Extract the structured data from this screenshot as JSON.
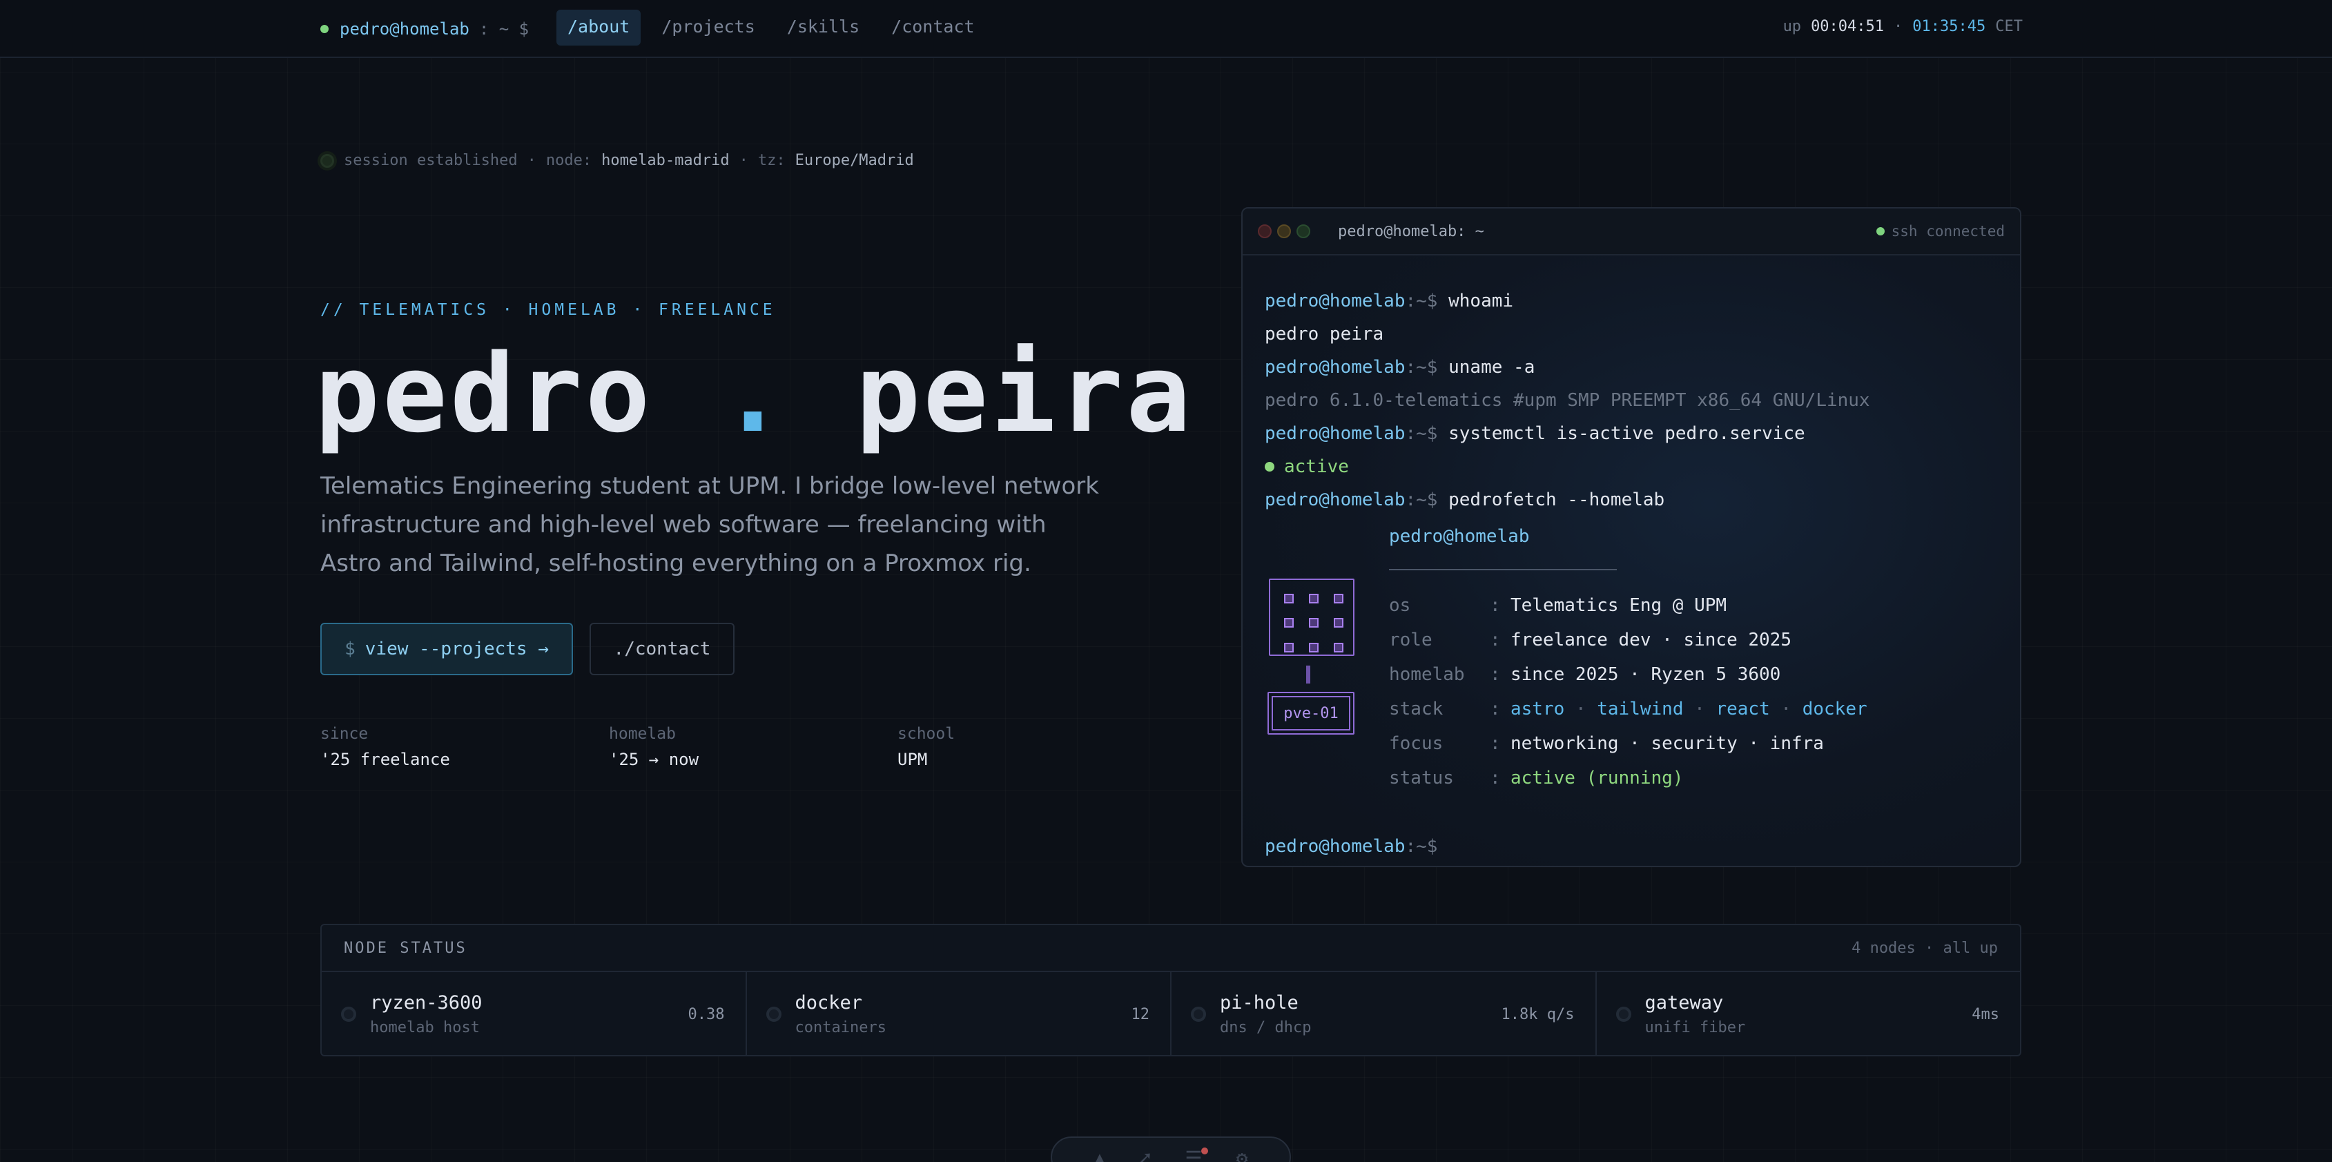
{
  "topbar": {
    "prompt_user": "pedro@homelab",
    "prompt_path": ": ~ $",
    "nav": [
      {
        "label": "/about",
        "active": true
      },
      {
        "label": "/projects",
        "active": false
      },
      {
        "label": "/skills",
        "active": false
      },
      {
        "label": "/contact",
        "active": false
      }
    ],
    "uptime_label": "up",
    "uptime_value": "00:04:51",
    "clock": "01:35:45",
    "timezone": "CET"
  },
  "session": {
    "status": "session established",
    "node_label": "node:",
    "node_value": "homelab-madrid",
    "tz_label": "tz:",
    "tz_value": "Europe/Madrid"
  },
  "hero": {
    "tagline": "// TELEMATICS · HOMELAB · FREELANCE",
    "name_first": "pedro",
    "name_dot": ".",
    "name_last": "peira",
    "description": "Telematics Engineering student at UPM. I bridge low-level network infrastructure and high-level web software — freelancing with Astro and Tailwind, self-hosting everything on a Proxmox rig.",
    "primary_button_prefix": "$",
    "primary_button": "view --projects →",
    "secondary_button": "./contact",
    "stats": [
      {
        "label": "since",
        "value": "'25 freelance"
      },
      {
        "label": "homelab",
        "value": "'25 → now"
      },
      {
        "label": "school",
        "value": "UPM"
      }
    ]
  },
  "terminal": {
    "title": "pedro@homelab: ~",
    "ssh_status": "ssh connected",
    "prompt_user": "pedro@homelab",
    "prompt_suffix": ":~$",
    "cmd1": "whoami",
    "out1": "pedro peira",
    "cmd2": "uname -a",
    "out2": "pedro 6.1.0-telematics #upm SMP PREEMPT x86_64 GNU/Linux",
    "cmd3": "systemctl is-active pedro.service",
    "out3": "active",
    "cmd4": "pedrofetch --homelab",
    "fetch_header": "pedro@homelab",
    "server_label": "pve-01",
    "fetch": {
      "os_key": "os",
      "os_val": "Telematics Eng @ UPM",
      "role_key": "role",
      "role_val": "freelance dev · since 2025",
      "homelab_key": "homelab",
      "homelab_val": "since 2025 · Ryzen 5 3600",
      "stack_key": "stack",
      "stack": [
        "astro",
        "tailwind",
        "react",
        "docker"
      ],
      "stack_sep": "·",
      "focus_key": "focus",
      "focus_val": "networking · security · infra",
      "status_key": "status",
      "status_val": "active (running)",
      "colon": ":"
    }
  },
  "node_status": {
    "title": "NODE STATUS",
    "summary": "4 nodes · all up",
    "nodes": [
      {
        "name": "ryzen-3600",
        "sub": "homelab host",
        "value": "0.38"
      },
      {
        "name": "docker",
        "sub": "containers",
        "value": "12"
      },
      {
        "name": "pi-hole",
        "sub": "dns / dhcp",
        "value": "1.8k q/s"
      },
      {
        "name": "gateway",
        "sub": "unifi fiber",
        "value": "4ms"
      }
    ]
  },
  "dock": {
    "icons": [
      "astro-icon",
      "rocket-icon",
      "menu-icon",
      "gear-icon"
    ]
  },
  "colors": {
    "background": "#0c1017",
    "accent": "#5eb8ea",
    "success": "#8fd87f",
    "purple": "#8f6bd6"
  }
}
